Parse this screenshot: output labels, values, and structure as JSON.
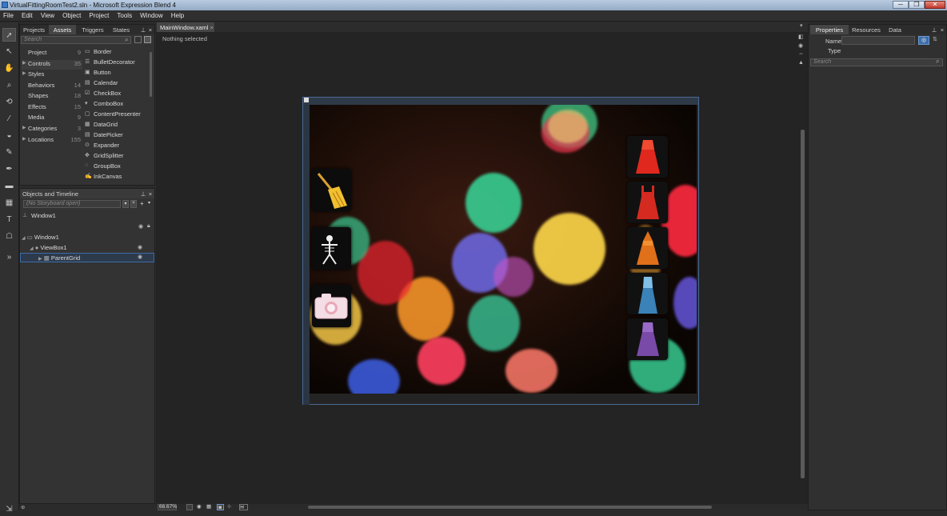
{
  "window": {
    "title": "VirtualFittingRoomTest2.sln - Microsoft Expression Blend 4",
    "minimize": "─",
    "restore": "❐",
    "close": "✕"
  },
  "menu": [
    "File",
    "Edit",
    "View",
    "Object",
    "Project",
    "Tools",
    "Window",
    "Help"
  ],
  "left_panel": {
    "tabs": [
      "Projects",
      "Assets",
      "Triggers",
      "States"
    ],
    "search_placeholder": "Search",
    "categories": [
      {
        "label": "Project",
        "count": "9",
        "arrow": ""
      },
      {
        "label": "Controls",
        "count": "35",
        "arrow": "▶"
      },
      {
        "label": "Styles",
        "count": "",
        "arrow": "▶"
      },
      {
        "label": "Behaviors",
        "count": "14",
        "arrow": ""
      },
      {
        "label": "Shapes",
        "count": "18",
        "arrow": ""
      },
      {
        "label": "Effects",
        "count": "15",
        "arrow": ""
      },
      {
        "label": "Media",
        "count": "9",
        "arrow": ""
      },
      {
        "label": "Categories",
        "count": "3",
        "arrow": "▶"
      },
      {
        "label": "Locations",
        "count": "155",
        "arrow": "▶"
      }
    ],
    "assets": [
      "Border",
      "BulletDecorator",
      "Button",
      "Calendar",
      "CheckBox",
      "ComboBox",
      "ContentPresenter",
      "DataGrid",
      "DatePicker",
      "Expander",
      "GridSplitter",
      "GroupBox",
      "InkCanvas"
    ]
  },
  "objects_panel": {
    "title": "Objects and Timeline",
    "storyboard": "(No Storyboard open)",
    "root": "Window1",
    "tree": [
      "Window1",
      "ViewBox1",
      "ParentGrid"
    ]
  },
  "document": {
    "tab": "MainWindow.xaml",
    "status": "Nothing selected",
    "zoom": "66.67%"
  },
  "properties_panel": {
    "tabs": [
      "Properties",
      "Resources",
      "Data"
    ],
    "name_label": "Name",
    "type_label": "Type",
    "search_placeholder": "Search"
  },
  "colors": {
    "accent_selection": "#3d6da8",
    "panel_bg": "#333333",
    "dress_colors": [
      "#e0281e",
      "#d42a20",
      "#e0701a",
      "#3a82b8",
      "#7a4aa8"
    ]
  }
}
